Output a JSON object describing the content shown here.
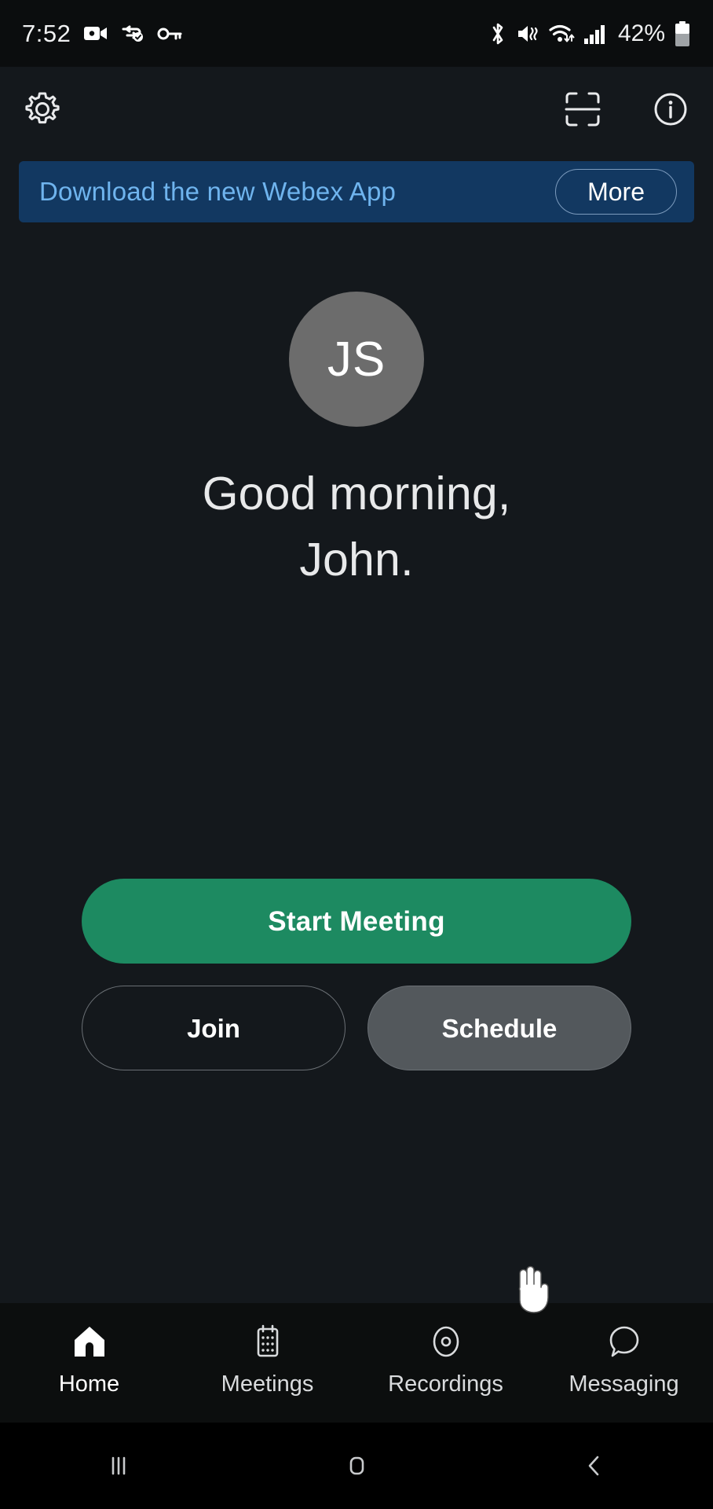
{
  "status_bar": {
    "time": "7:52",
    "battery_percent": "42%",
    "left_icons": [
      "camera-icon",
      "vpn-icon",
      "key-icon"
    ],
    "right_icons": [
      "bluetooth-icon",
      "mute-vibrate-icon",
      "wifi-icon",
      "signal-icon",
      "battery-icon"
    ]
  },
  "app_bar": {
    "settings_icon": "gear-icon",
    "scan_icon": "scan-icon",
    "info_icon": "info-icon"
  },
  "banner": {
    "text": "Download the new Webex App",
    "more_label": "More",
    "background_color": "#123861",
    "text_color": "#6fb4ee"
  },
  "profile": {
    "initials": "JS",
    "avatar_color": "#6c6c6c",
    "greeting_line1": "Good morning,",
    "greeting_line2": "John."
  },
  "actions": {
    "start_meeting_label": "Start Meeting",
    "start_meeting_color": "#1d8a61",
    "join_label": "Join",
    "schedule_label": "Schedule",
    "schedule_state": "pressed"
  },
  "bottom_nav": {
    "items": [
      {
        "label": "Home",
        "icon": "home-icon",
        "active": true
      },
      {
        "label": "Meetings",
        "icon": "calendar-icon",
        "active": false
      },
      {
        "label": "Recordings",
        "icon": "record-circle-icon",
        "active": false
      },
      {
        "label": "Messaging",
        "icon": "chat-bubble-icon",
        "active": false
      }
    ]
  },
  "system_nav": {
    "recents_icon": "recents-icon",
    "home_icon": "home-square-icon",
    "back_icon": "back-chevron-icon"
  }
}
